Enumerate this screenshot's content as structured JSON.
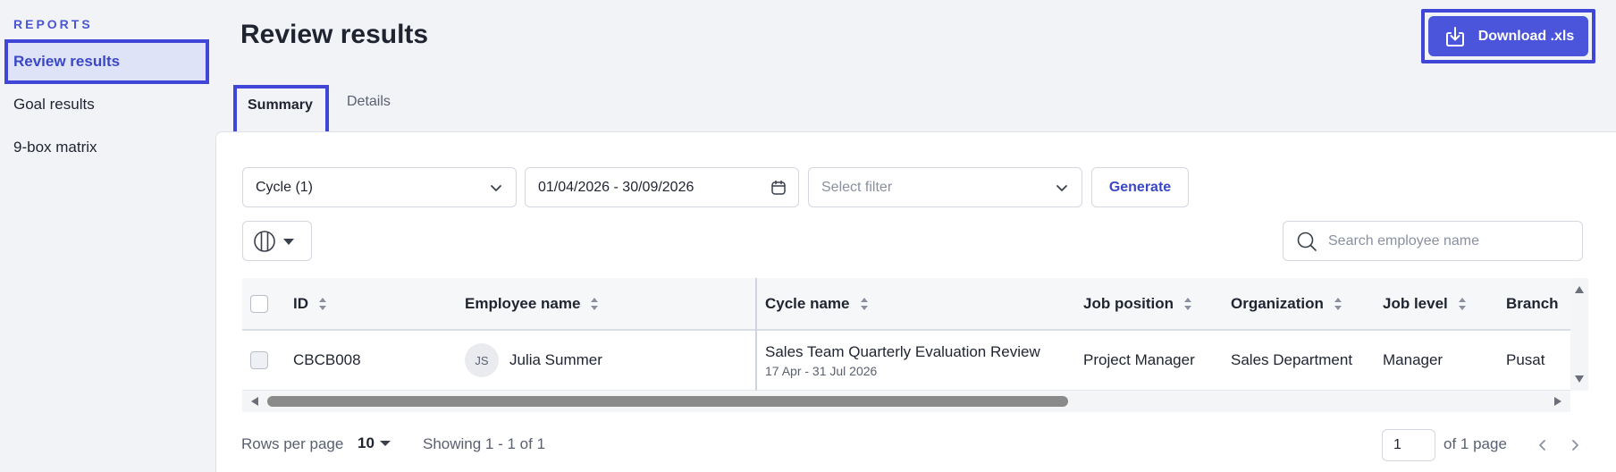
{
  "sidebar": {
    "section": "REPORTS",
    "items": [
      {
        "label": "Review results"
      },
      {
        "label": "Goal results"
      },
      {
        "label": "9-box matrix"
      }
    ]
  },
  "header": {
    "title": "Review results",
    "download_label": "Download .xls"
  },
  "tabs": [
    {
      "label": "Summary"
    },
    {
      "label": "Details"
    }
  ],
  "filters": {
    "cycle": "Cycle (1)",
    "date_range": "01/04/2026 - 30/09/2026",
    "filter_placeholder": "Select filter",
    "generate_label": "Generate",
    "search_placeholder": "Search employee name"
  },
  "table": {
    "columns": [
      "ID",
      "Employee name",
      "Cycle name",
      "Job position",
      "Organization",
      "Job level",
      "Branch"
    ],
    "rows": [
      {
        "id": "CBCB008",
        "initials": "JS",
        "employee": "Julia Summer",
        "cycle": "Sales Team Quarterly Evaluation Review",
        "cycle_dates": "17 Apr - 31 Jul 2026",
        "position": "Project Manager",
        "organization": "Sales Department",
        "level": "Manager",
        "branch": "Pusat"
      }
    ]
  },
  "footer": {
    "rows_per_page_label": "Rows per page",
    "rows_per_page": "10",
    "showing": "Showing 1 - 1 of 1",
    "page": "1",
    "of_pages": "of 1 page"
  },
  "colors": {
    "accent": "#4a55dc",
    "highlight": "#4047d6"
  }
}
